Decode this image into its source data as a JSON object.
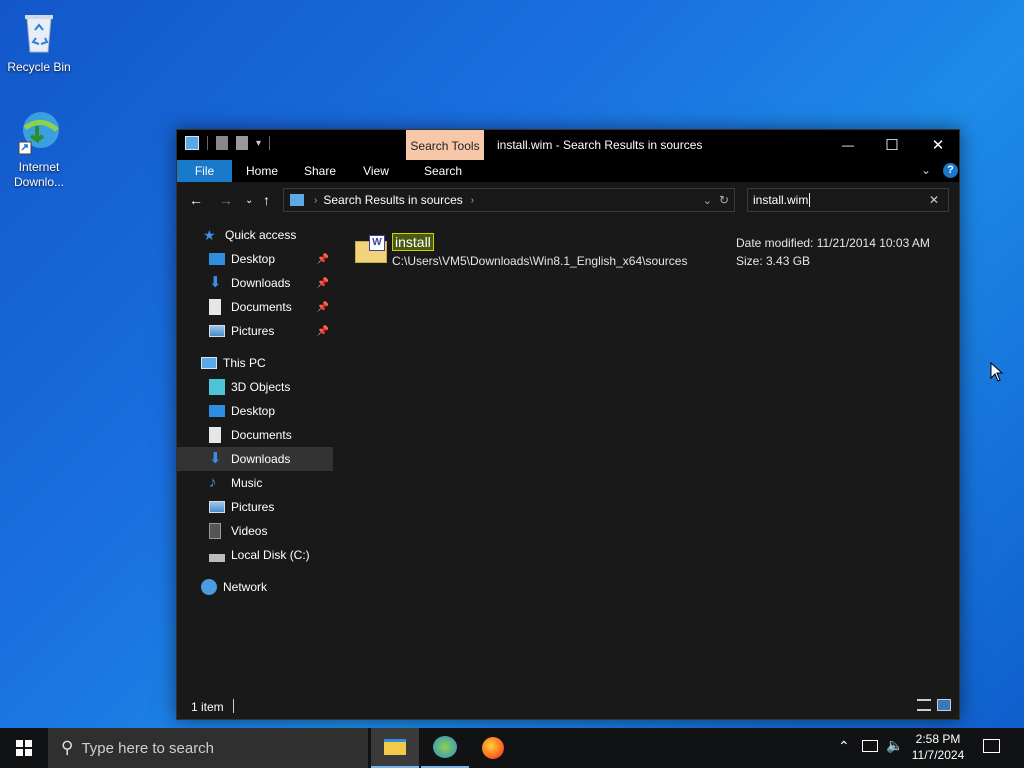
{
  "desktop": {
    "icons": [
      {
        "label": "Recycle Bin",
        "icon": "recycle-bin-icon"
      },
      {
        "label": "Internet Downlo...",
        "icon": "internet-download-manager-icon"
      }
    ]
  },
  "window": {
    "context_tab": "Search Tools",
    "title": "install.wim - Search Results in sources",
    "controls": {
      "minimize": "—",
      "maximize": "☐",
      "close": "✕"
    },
    "ribbon_tabs": [
      "File",
      "Home",
      "Share",
      "View",
      "Search"
    ],
    "address": "Search Results in sources",
    "search_value": "install.wim",
    "nav": {
      "quick_access": "Quick access",
      "quick_items": [
        "Desktop",
        "Downloads",
        "Documents",
        "Pictures"
      ],
      "this_pc": "This PC",
      "pc_items": [
        "3D Objects",
        "Desktop",
        "Documents",
        "Downloads",
        "Music",
        "Pictures",
        "Videos",
        "Local Disk (C:)"
      ],
      "network": "Network",
      "selected": "Downloads"
    },
    "result": {
      "name": "install",
      "path": "C:\\Users\\VM5\\Downloads\\Win8.1_English_x64\\sources",
      "date_label": "Date modified: 11/21/2014 10:03 AM",
      "size_label": "Size: 3.43 GB"
    },
    "status": {
      "count": "1 item"
    }
  },
  "taskbar": {
    "search_placeholder": "Type here to search",
    "time": "2:58 PM",
    "date": "11/7/2024"
  },
  "colors": {
    "accent": "#1979ca",
    "context_tab": "#f6c7a8",
    "highlight": "#fff200"
  }
}
